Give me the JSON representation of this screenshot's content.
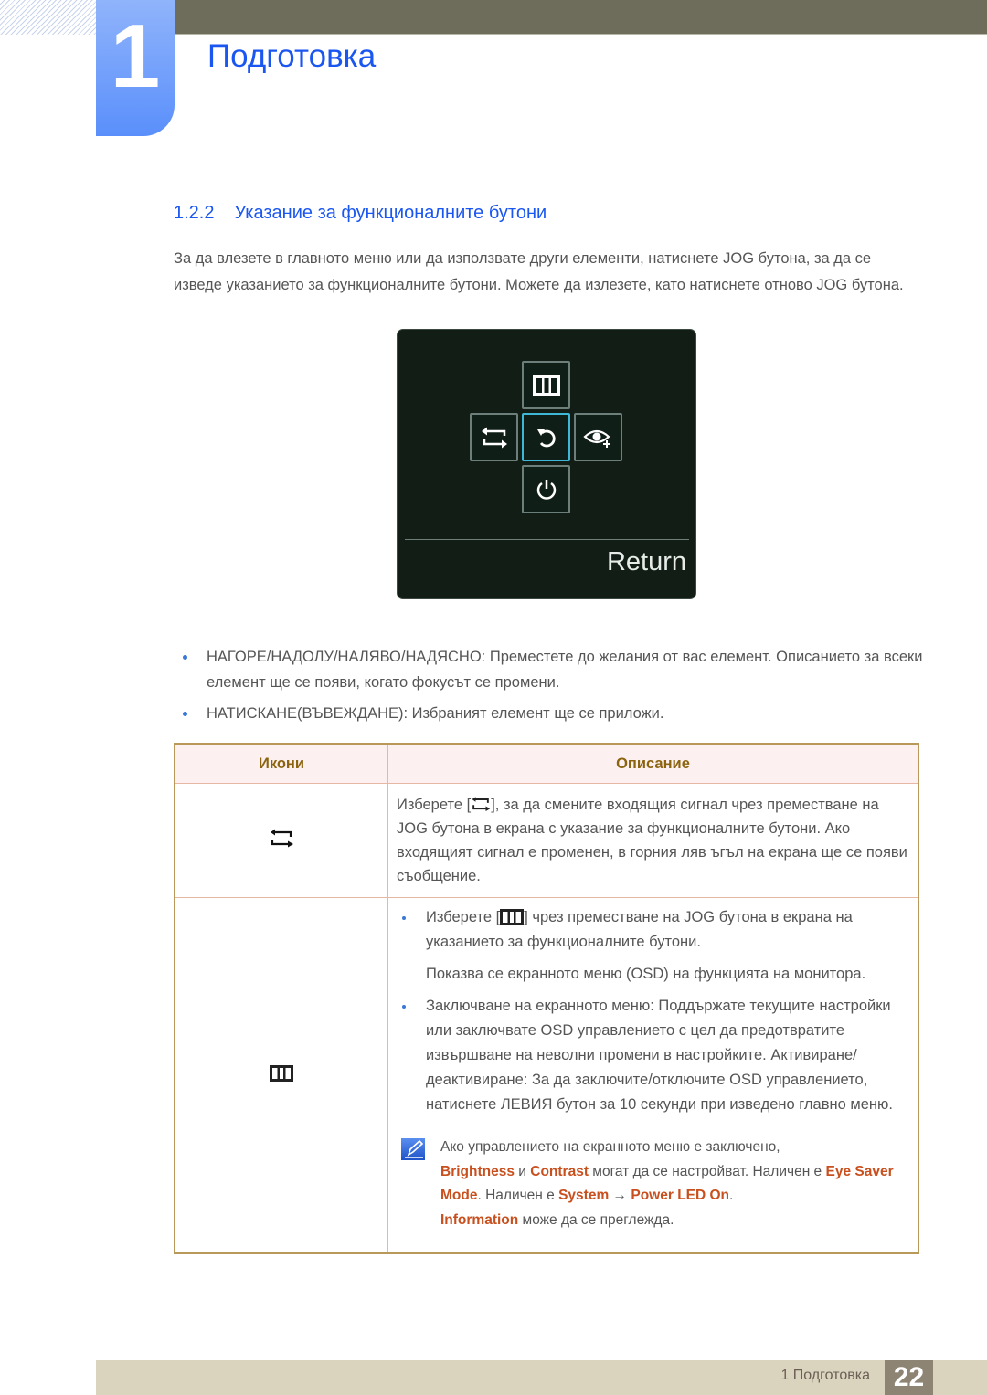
{
  "header": {
    "chapter_number": "1",
    "chapter_title": "Подготовка"
  },
  "section": {
    "number": "1.2.2",
    "title": "Указание за функционалните бутони"
  },
  "intro_text": "За да влезете в главното меню или да използвате други елементи, натиснете JOG бутона, за да се изведе указанието за функционалните бутони. Можете да излезете, като натиснете отново JOG бутона.",
  "jog_guide": {
    "buttons": [
      {
        "position": "up",
        "icon": "menu-icon"
      },
      {
        "position": "left",
        "icon": "source-switch-icon"
      },
      {
        "position": "center",
        "icon": "return-icon",
        "active": true
      },
      {
        "position": "right",
        "icon": "eye-saver-icon"
      },
      {
        "position": "down",
        "icon": "power-icon"
      }
    ],
    "label": "Return",
    "accent_color": "#3fb7d6"
  },
  "bullets": [
    "НАГОРЕ/НАДОЛУ/НАЛЯВО/НАДЯСНО: Преместете до желания от вас елемент. Описанието за всеки елемент ще се появи, когато фокусът се промени.",
    "НАТИСКАНЕ(ВЪВЕЖДАНЕ): Избраният елемент ще се приложи."
  ],
  "table": {
    "headers": [
      "Икони",
      "Описание"
    ],
    "rows": [
      {
        "icon": "source-switch-icon",
        "desc_before": "Изберете [",
        "desc_after": "], за да смените входящия сигнал чрез преместване на JOG бутона в екрана с указание за функционалните бутони. Ако входящият сигнал е променен, в горния ляв ъгъл на екрана ще се появи съобщение."
      },
      {
        "icon": "menu-icon",
        "bullet1_before": "Изберете [",
        "bullet1_after": "] чрез преместване на JOG бутона в екрана на указанието за функционалните бутони.",
        "bullet1_para": "Показва се екранното меню (OSD) на функцията на монитора.",
        "bullet2": "Заключване на екранното меню: Поддържате текущите настройки или заключвате OSD управлението с цел да предотвратите извършване на неволни промени в настройките. Активиране/деактивиране: За да заключите/отключите OSD управлението, натиснете ЛЕВИЯ бутон за 10 секунди при изведено главно меню.",
        "note": {
          "icon": "note-pencil-icon",
          "line1": "Ако управлението на екранното меню е заключено,",
          "brightness": "Brightness",
          "and": " и ",
          "contrast": "Contrast",
          "text1": " могат да се настройват. Наличен е ",
          "eye_saver": "Eye Saver Mode",
          "text2": ". Наличен е ",
          "system": "System",
          "arrow": " → ",
          "power_led": "Power LED On",
          "text3": ".",
          "information": "Information",
          "text4": " може да се преглежда."
        }
      }
    ]
  },
  "footer": {
    "chapter_label": "1 Подготовка",
    "page_number": "22"
  },
  "colors": {
    "title_blue": "#1a56f0",
    "highlight_orange": "#c8501e",
    "table_header_text": "#8c6410"
  }
}
